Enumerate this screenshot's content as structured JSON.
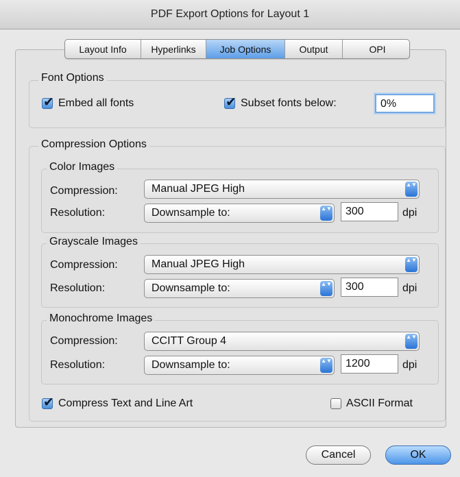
{
  "window": {
    "title": "PDF Export Options for Layout 1"
  },
  "tabs": [
    {
      "label": "Layout Info"
    },
    {
      "label": "Hyperlinks"
    },
    {
      "label": "Job Options"
    },
    {
      "label": "Output"
    },
    {
      "label": "OPI"
    }
  ],
  "active_tab": "Job Options",
  "font_options": {
    "legend": "Font Options",
    "embed_all_fonts": {
      "label": "Embed all fonts",
      "checked": true
    },
    "subset_fonts_below": {
      "label": "Subset fonts below:",
      "checked": true,
      "value": "0%"
    }
  },
  "compression_options": {
    "legend": "Compression Options",
    "color_images": {
      "legend": "Color Images",
      "compression_label": "Compression:",
      "compression_value": "Manual JPEG High",
      "resolution_label": "Resolution:",
      "resolution_value": "Downsample to:",
      "dpi_value": "300",
      "dpi_unit": "dpi"
    },
    "grayscale_images": {
      "legend": "Grayscale Images",
      "compression_label": "Compression:",
      "compression_value": "Manual JPEG High",
      "resolution_label": "Resolution:",
      "resolution_value": "Downsample to:",
      "dpi_value": "300",
      "dpi_unit": "dpi"
    },
    "monochrome_images": {
      "legend": "Monochrome Images",
      "compression_label": "Compression:",
      "compression_value": "CCITT Group 4",
      "resolution_label": "Resolution:",
      "resolution_value": "Downsample to:",
      "dpi_value": "1200",
      "dpi_unit": "dpi"
    },
    "compress_text": {
      "label": "Compress Text and Line Art",
      "checked": true
    },
    "ascii_format": {
      "label": "ASCII Format",
      "checked": false
    }
  },
  "buttons": {
    "cancel": "Cancel",
    "ok": "OK"
  },
  "icons": {
    "checkmark": "✔",
    "popup_arrows": "▲▼"
  },
  "colors": {
    "accent": "#4b8fdb",
    "window_bg": "#e8e8e8"
  }
}
